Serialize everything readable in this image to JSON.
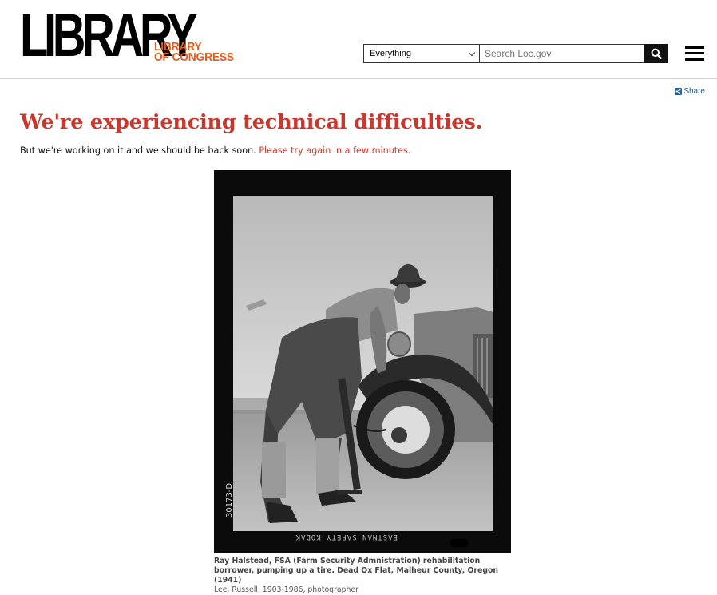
{
  "header": {
    "logo_word": "LIBRARY",
    "logo_sub_line1": "LIBRARY",
    "logo_sub_line2": "OF CONGRESS",
    "search_scope": "Everything",
    "search_placeholder": "Search Loc.gov"
  },
  "share_label": "Share",
  "content": {
    "headline": "We're experiencing technical difficulties.",
    "subline_text": "But we're working on it and we should be back soon. ",
    "subline_link": "Please try again in a few minutes."
  },
  "photo": {
    "caption_title": "Ray Halstead, FSA (Farm Security Admnistration) rehabilitation borrower, pumping up a tire. Dead Ox Flat, Malheur County, Oregon (1941)",
    "caption_credit": "Lee, Russell, 1903-1986, photographer",
    "film_edge_text": "EASTMAN SAFETY KODAK",
    "negative_number": "30173-D"
  },
  "colors": {
    "accent_red": "#c9382f",
    "logo_orange": "#e85a1a",
    "link_blue": "#1a5f9e"
  }
}
